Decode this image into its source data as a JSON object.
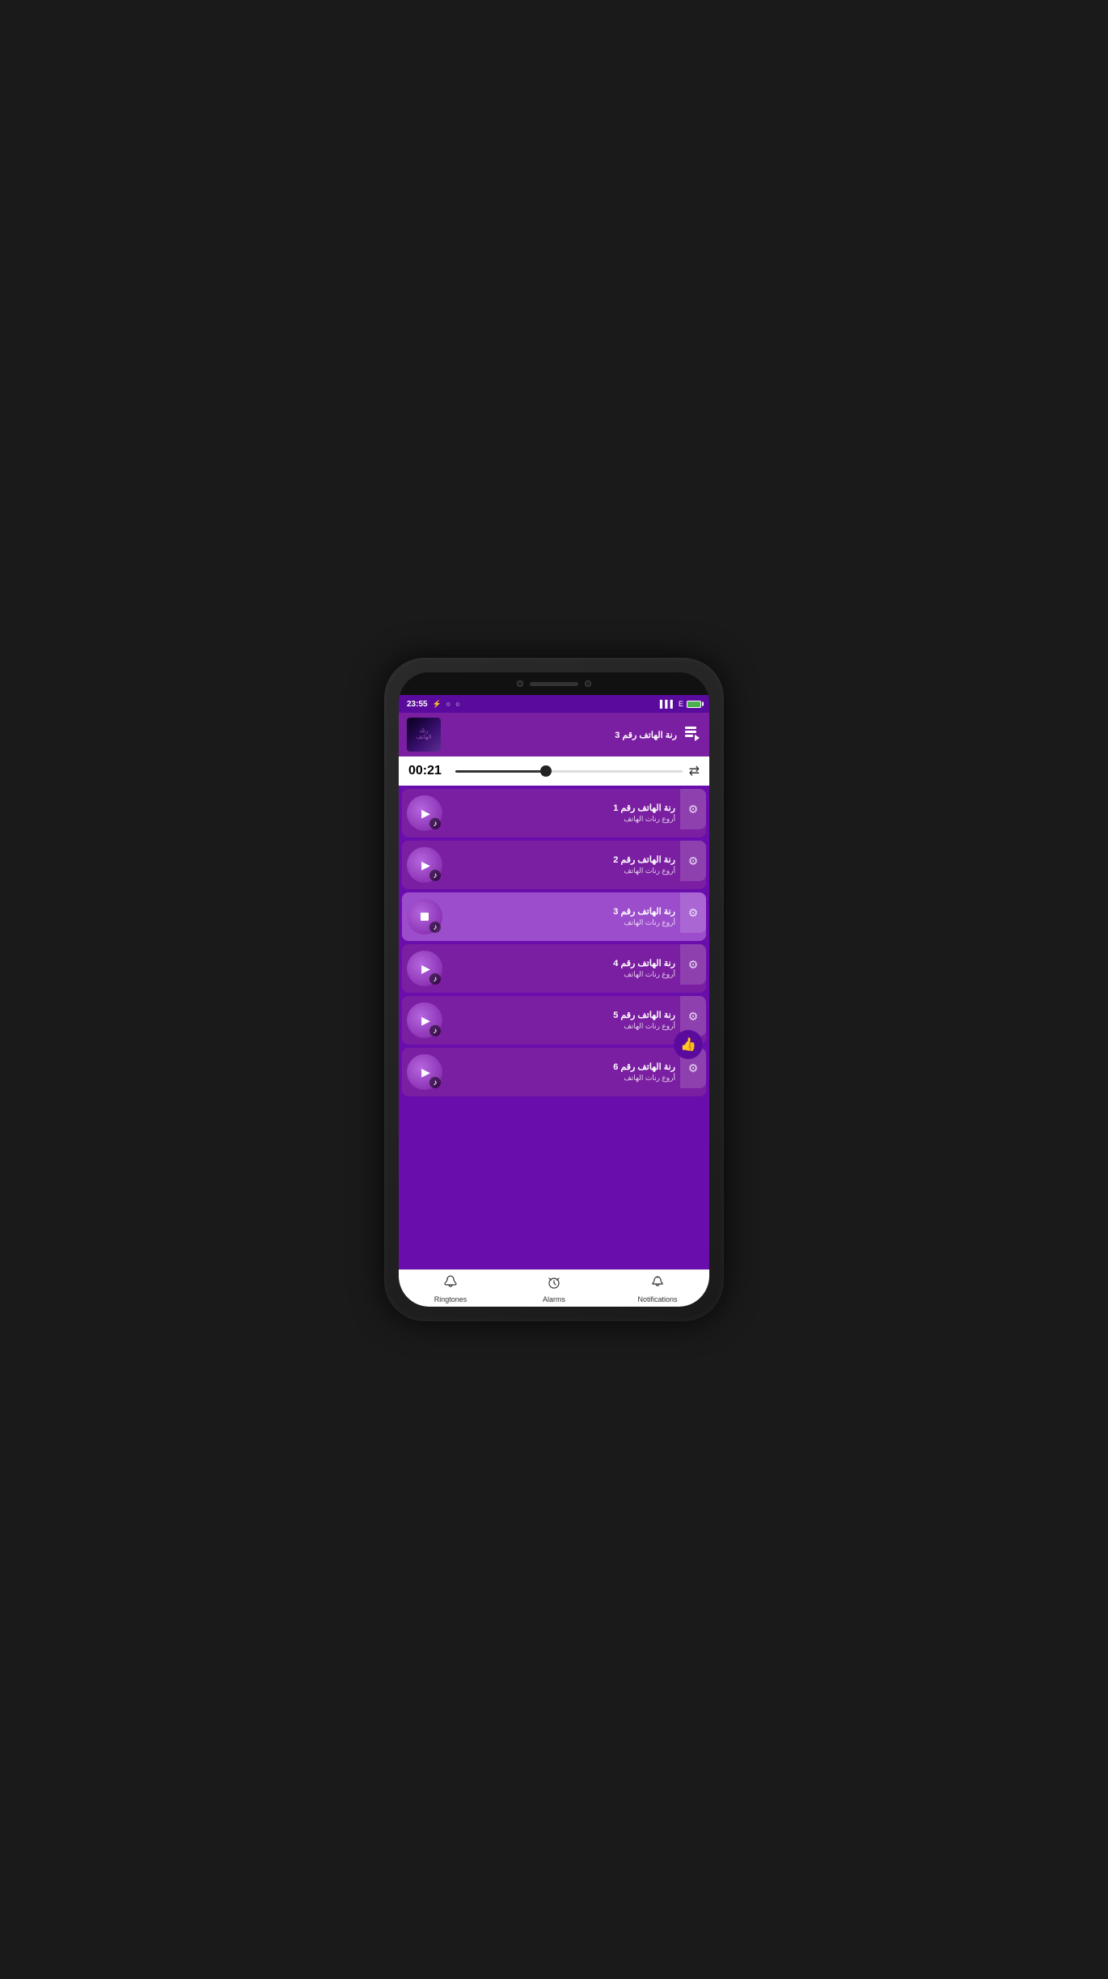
{
  "statusBar": {
    "time": "23:55",
    "icons": [
      "⚡",
      "○",
      "○"
    ],
    "signalText": "E"
  },
  "nowPlaying": {
    "title": "رنة الهاتف رقم 3",
    "time": "00:21",
    "progressPercent": 40
  },
  "bottomNav": {
    "items": [
      {
        "id": "ringtones",
        "label": "Ringtones",
        "icon": "📳"
      },
      {
        "id": "alarms",
        "label": "Alarms",
        "icon": "⏰"
      },
      {
        "id": "notifications",
        "label": "Notifications",
        "icon": "🔔"
      }
    ]
  },
  "songs": [
    {
      "id": 1,
      "title": "رنة الهاتف رقم 1",
      "artist": "أروع رنات الهاتف",
      "active": false,
      "playing": true
    },
    {
      "id": 2,
      "title": "رنة الهاتف رقم 2",
      "artist": "أروع رنات الهاتف",
      "active": false,
      "playing": true
    },
    {
      "id": 3,
      "title": "رنة الهاتف رقم 3",
      "artist": "أروع رنات الهاتف",
      "active": true,
      "playing": false
    },
    {
      "id": 4,
      "title": "رنة الهاتف رقم 4",
      "artist": "أروع رنات الهاتف",
      "active": false,
      "playing": true
    },
    {
      "id": 5,
      "title": "رنة الهاتف رقم 5",
      "artist": "أروع رنات الهاتف",
      "active": false,
      "playing": true
    },
    {
      "id": 6,
      "title": "رنة الهاتف رقم 6",
      "artist": "أروع رنات الهاتف",
      "active": false,
      "playing": true
    }
  ],
  "labels": {
    "playlistIcon": "▶",
    "repeatIcon": "↺",
    "ringtonesLabel": "Ringtones",
    "alarmsLabel": "Alarms",
    "notificationsLabel": "Notifications"
  }
}
